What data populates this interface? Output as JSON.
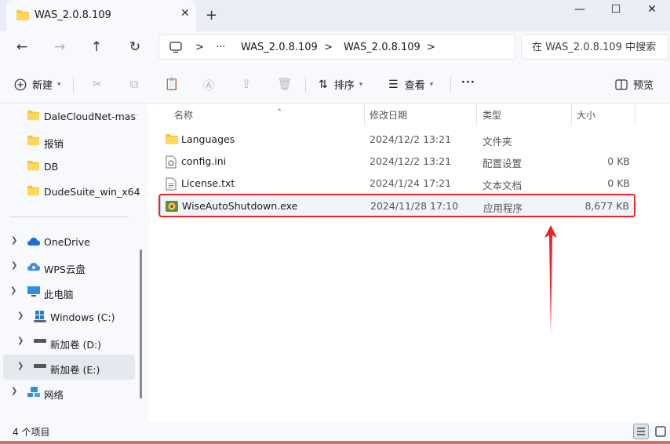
{
  "window": {
    "tab_title": "WAS_2.0.8.109",
    "tab_close": "✕",
    "new_tab": "+",
    "minimize": "—",
    "maximize": "☐",
    "close": "✕"
  },
  "nav_buttons": {
    "back": "←",
    "forward": "→",
    "up": "↑",
    "refresh": "↻"
  },
  "address": {
    "monitor_icon": "monitor-icon",
    "sep1": ">",
    "ellipsis": "···",
    "crumb1": "WAS_2.0.8.109",
    "sep2": ">",
    "crumb2": "WAS_2.0.8.109",
    "sep3": ">"
  },
  "search": {
    "placeholder": "在 WAS_2.0.8.109 中搜索"
  },
  "toolbar": {
    "new_label": "新建",
    "sort_label": "排序",
    "view_label": "查看",
    "more_label": "···",
    "preview_label": "预览"
  },
  "nav_pane": {
    "quick_items": [
      {
        "label": "DaleCloudNet-maste"
      },
      {
        "label": "报销"
      },
      {
        "label": "DB"
      },
      {
        "label": "DudeSuite_win_x64"
      }
    ],
    "tree": [
      {
        "label": "OneDrive"
      },
      {
        "label": "WPS云盘"
      },
      {
        "label": "此电脑"
      },
      {
        "label": "Windows (C:)"
      },
      {
        "label": "新加卷 (D:)"
      },
      {
        "label": "新加卷 (E:)"
      },
      {
        "label": "网络"
      }
    ]
  },
  "columns": {
    "name": "名称",
    "date": "修改日期",
    "type": "类型",
    "size": "大小"
  },
  "files": [
    {
      "name": "Languages",
      "date": "2024/12/2 13:21",
      "type": "文件夹",
      "size": ""
    },
    {
      "name": "config.ini",
      "date": "2024/12/2 13:21",
      "type": "配置设置",
      "size": "0 KB"
    },
    {
      "name": "License.txt",
      "date": "2024/1/24 17:21",
      "type": "文本文档",
      "size": "0 KB"
    },
    {
      "name": "WiseAutoShutdown.exe",
      "date": "2024/11/28 17:10",
      "type": "应用程序",
      "size": "8,677 KB"
    }
  ],
  "status": {
    "count": "4 个项目"
  },
  "colors": {
    "folder": "#f4c340",
    "annotation_red": "#ee2424",
    "selection": "#e5e8ee"
  }
}
